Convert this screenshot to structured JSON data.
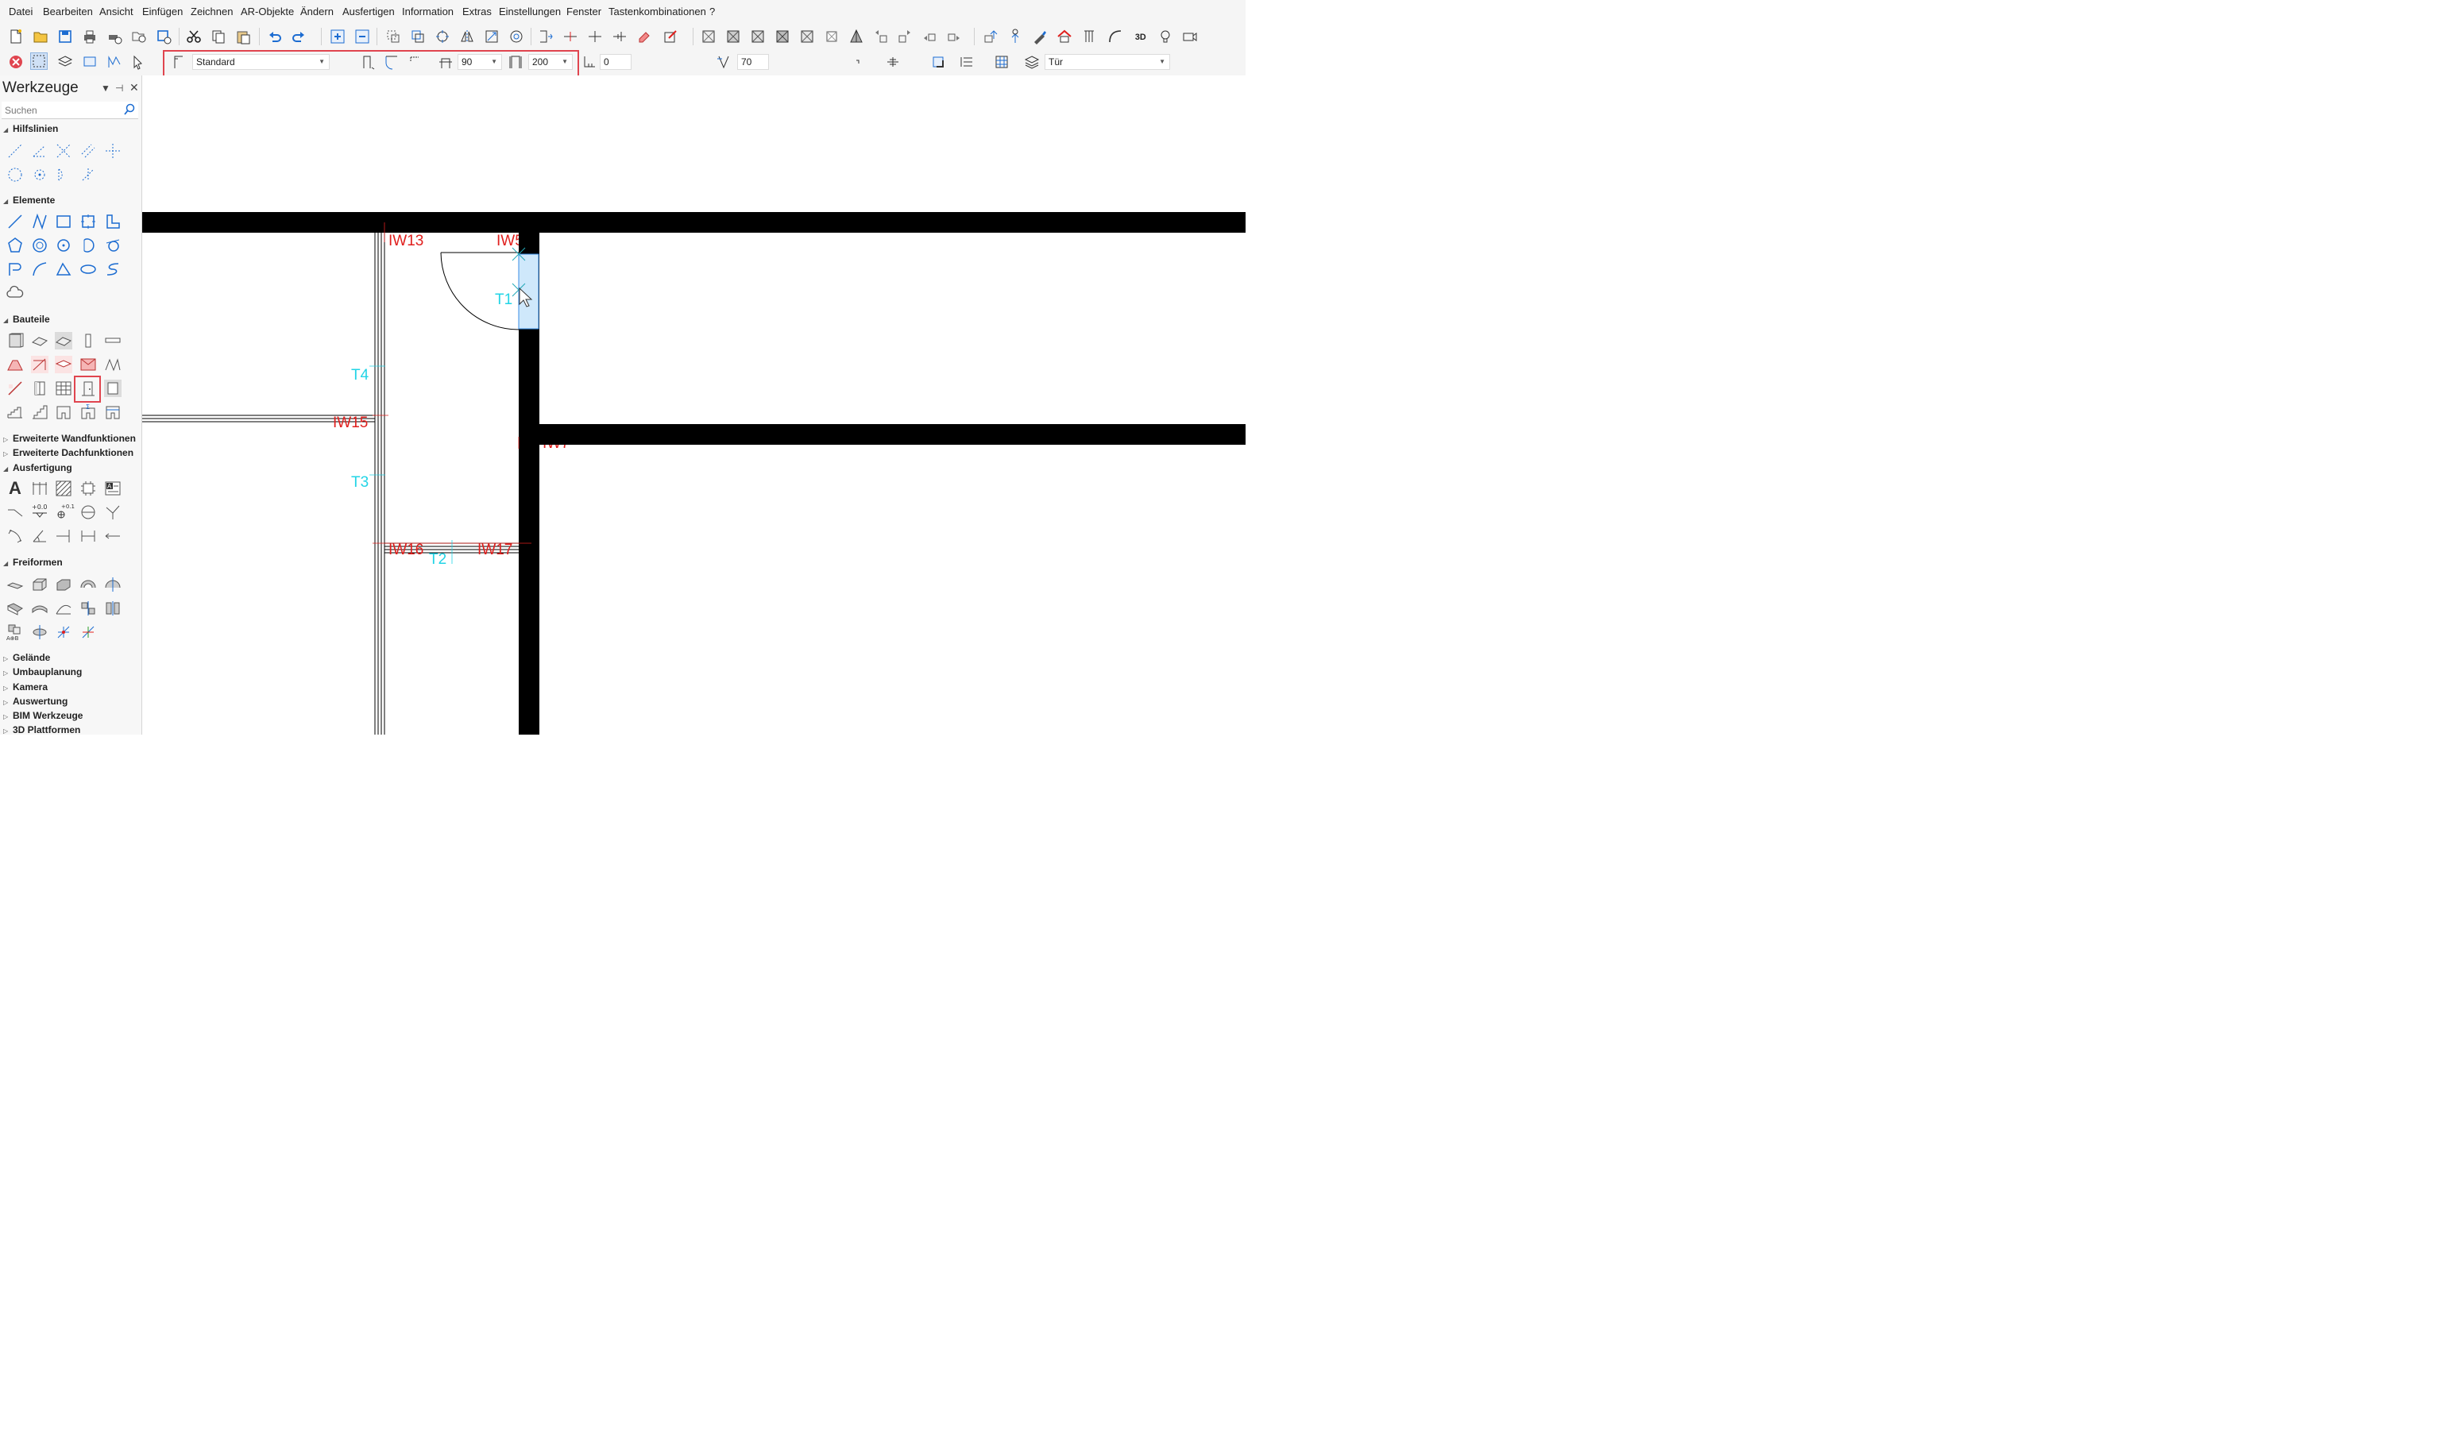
{
  "menu": [
    "Datei",
    "Bearbeiten",
    "Ansicht",
    "Einfügen",
    "Zeichnen",
    "AR-Objekte",
    "Ändern",
    "Ausfertigen",
    "Information",
    "Extras",
    "Einstellungen",
    "Fenster",
    "Tastenkombinationen",
    "?"
  ],
  "props": {
    "style": "Standard",
    "width": "90",
    "height": "200",
    "offset": "0",
    "angle": "70",
    "layer": "Tür"
  },
  "panel": {
    "title": "Werkzeuge",
    "search_placeholder": "Suchen",
    "sections": {
      "hilfslinien": "Hilfslinien",
      "elemente": "Elemente",
      "bauteile": "Bauteile",
      "erw_wand": "Erweiterte Wandfunktionen",
      "erw_dach": "Erweiterte Dachfunktionen",
      "ausfertigung": "Ausfertigung",
      "freiformen": "Freiformen",
      "gelaende": "Gelände",
      "umbau": "Umbauplanung",
      "kamera": "Kamera",
      "auswertung": "Auswertung",
      "bim": "BIM Werkzeuge",
      "plattformen": "3D Plattformen"
    },
    "text_tool": "A",
    "dim1": "+0.0",
    "dim2": "+0.1",
    "aob": "A⊕B"
  },
  "drawing": {
    "walls": [
      "IW13",
      "IW5",
      "IW15",
      "IW16",
      "IW17",
      "IW7"
    ],
    "doors": [
      "T1",
      "T2",
      "T3",
      "T4"
    ]
  },
  "colors": {
    "wall_label": "#e0201e",
    "door_label": "#22d4e6",
    "highlight": "#e0454f",
    "accent": "#1c6cd1"
  }
}
